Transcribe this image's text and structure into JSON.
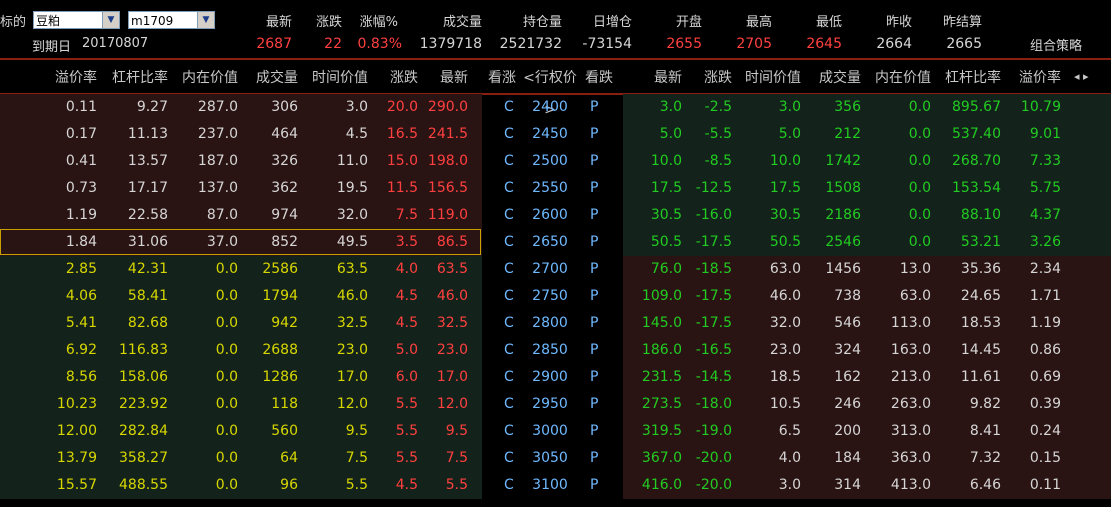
{
  "header": {
    "underlying_label": "标的",
    "underlying_value": "豆粕",
    "contract_value": "m1709",
    "expiry_label": "到期日",
    "expiry_value": "20170807",
    "metrics": [
      {
        "label": "最新",
        "value": "2687",
        "color": "red"
      },
      {
        "label": "涨跌",
        "value": "22",
        "color": "red"
      },
      {
        "label": "涨幅%",
        "value": "0.83%",
        "color": "red"
      },
      {
        "label": "成交量",
        "value": "1379718",
        "color": "white"
      },
      {
        "label": "持仓量",
        "value": "2521732",
        "color": "white"
      },
      {
        "label": "日增仓",
        "value": "-73154",
        "color": "white"
      },
      {
        "label": "开盘",
        "value": "2655",
        "color": "red"
      },
      {
        "label": "最高",
        "value": "2705",
        "color": "red"
      },
      {
        "label": "最低",
        "value": "2645",
        "color": "red"
      },
      {
        "label": "昨收",
        "value": "2664",
        "color": "white"
      },
      {
        "label": "昨结算",
        "value": "2665",
        "color": "white"
      }
    ],
    "strategy_button": "组合策略"
  },
  "columns": {
    "call": [
      "溢价率",
      "杠杆比率",
      "内在价值",
      "成交量",
      "时间价值",
      "涨跌",
      "最新"
    ],
    "middle": [
      "看涨",
      "<行权价>",
      "看跌"
    ],
    "put": [
      "最新",
      "涨跌",
      "时间价值",
      "成交量",
      "内在价值",
      "杠杆比率",
      "溢价率"
    ],
    "nav": "◂ ▸"
  },
  "colors": {
    "itm_call_bg": "#2a1313",
    "otm_call_bg": "#13221a",
    "itm_put_bg": "#2a1313",
    "otm_put_bg": "#13221a",
    "selected_border": "#c8a000",
    "call_yellow": "#d7d700",
    "red": "#ff4040",
    "green": "#22cc22",
    "cyan": "#6fb9ff"
  },
  "rows": [
    {
      "call": [
        "0.11",
        "9.27",
        "287.0",
        "306",
        "3.0",
        "20.0",
        "290.0"
      ],
      "cp": "C",
      "strike": "2400",
      "pp": "P",
      "put": [
        "3.0",
        "-2.5",
        "3.0",
        "356",
        "0.0",
        "895.67",
        "10.79"
      ]
    },
    {
      "call": [
        "0.17",
        "11.13",
        "237.0",
        "464",
        "4.5",
        "16.5",
        "241.5"
      ],
      "cp": "C",
      "strike": "2450",
      "pp": "P",
      "put": [
        "5.0",
        "-5.5",
        "5.0",
        "212",
        "0.0",
        "537.40",
        "9.01"
      ]
    },
    {
      "call": [
        "0.41",
        "13.57",
        "187.0",
        "326",
        "11.0",
        "15.0",
        "198.0"
      ],
      "cp": "C",
      "strike": "2500",
      "pp": "P",
      "put": [
        "10.0",
        "-8.5",
        "10.0",
        "1742",
        "0.0",
        "268.70",
        "7.33"
      ]
    },
    {
      "call": [
        "0.73",
        "17.17",
        "137.0",
        "362",
        "19.5",
        "11.5",
        "156.5"
      ],
      "cp": "C",
      "strike": "2550",
      "pp": "P",
      "put": [
        "17.5",
        "-12.5",
        "17.5",
        "1508",
        "0.0",
        "153.54",
        "5.75"
      ]
    },
    {
      "call": [
        "1.19",
        "22.58",
        "87.0",
        "974",
        "32.0",
        "7.5",
        "119.0"
      ],
      "cp": "C",
      "strike": "2600",
      "pp": "P",
      "put": [
        "30.5",
        "-16.0",
        "30.5",
        "2186",
        "0.0",
        "88.10",
        "4.37"
      ]
    },
    {
      "call": [
        "1.84",
        "31.06",
        "37.0",
        "852",
        "49.5",
        "3.5",
        "86.5"
      ],
      "cp": "C",
      "strike": "2650",
      "pp": "P",
      "put": [
        "50.5",
        "-17.5",
        "50.5",
        "2546",
        "0.0",
        "53.21",
        "3.26"
      ]
    },
    {
      "call": [
        "2.85",
        "42.31",
        "0.0",
        "2586",
        "63.5",
        "4.0",
        "63.5"
      ],
      "cp": "C",
      "strike": "2700",
      "pp": "P",
      "put": [
        "76.0",
        "-18.5",
        "63.0",
        "1456",
        "13.0",
        "35.36",
        "2.34"
      ]
    },
    {
      "call": [
        "4.06",
        "58.41",
        "0.0",
        "1794",
        "46.0",
        "4.5",
        "46.0"
      ],
      "cp": "C",
      "strike": "2750",
      "pp": "P",
      "put": [
        "109.0",
        "-17.5",
        "46.0",
        "738",
        "63.0",
        "24.65",
        "1.71"
      ]
    },
    {
      "call": [
        "5.41",
        "82.68",
        "0.0",
        "942",
        "32.5",
        "4.5",
        "32.5"
      ],
      "cp": "C",
      "strike": "2800",
      "pp": "P",
      "put": [
        "145.0",
        "-17.5",
        "32.0",
        "546",
        "113.0",
        "18.53",
        "1.19"
      ]
    },
    {
      "call": [
        "6.92",
        "116.83",
        "0.0",
        "2688",
        "23.0",
        "5.0",
        "23.0"
      ],
      "cp": "C",
      "strike": "2850",
      "pp": "P",
      "put": [
        "186.0",
        "-16.5",
        "23.0",
        "324",
        "163.0",
        "14.45",
        "0.86"
      ]
    },
    {
      "call": [
        "8.56",
        "158.06",
        "0.0",
        "1286",
        "17.0",
        "6.0",
        "17.0"
      ],
      "cp": "C",
      "strike": "2900",
      "pp": "P",
      "put": [
        "231.5",
        "-14.5",
        "18.5",
        "162",
        "213.0",
        "11.61",
        "0.69"
      ]
    },
    {
      "call": [
        "10.23",
        "223.92",
        "0.0",
        "118",
        "12.0",
        "5.5",
        "12.0"
      ],
      "cp": "C",
      "strike": "2950",
      "pp": "P",
      "put": [
        "273.5",
        "-18.0",
        "10.5",
        "246",
        "263.0",
        "9.82",
        "0.39"
      ]
    },
    {
      "call": [
        "12.00",
        "282.84",
        "0.0",
        "560",
        "9.5",
        "5.5",
        "9.5"
      ],
      "cp": "C",
      "strike": "3000",
      "pp": "P",
      "put": [
        "319.5",
        "-19.0",
        "6.5",
        "200",
        "313.0",
        "8.41",
        "0.24"
      ]
    },
    {
      "call": [
        "13.79",
        "358.27",
        "0.0",
        "64",
        "7.5",
        "5.5",
        "7.5"
      ],
      "cp": "C",
      "strike": "3050",
      "pp": "P",
      "put": [
        "367.0",
        "-20.0",
        "4.0",
        "184",
        "363.0",
        "7.32",
        "0.15"
      ]
    },
    {
      "call": [
        "15.57",
        "488.55",
        "0.0",
        "96",
        "5.5",
        "4.5",
        "5.5"
      ],
      "cp": "C",
      "strike": "3100",
      "pp": "P",
      "put": [
        "416.0",
        "-20.0",
        "3.0",
        "314",
        "413.0",
        "6.46",
        "0.11"
      ]
    }
  ],
  "selected_row_index": 5
}
